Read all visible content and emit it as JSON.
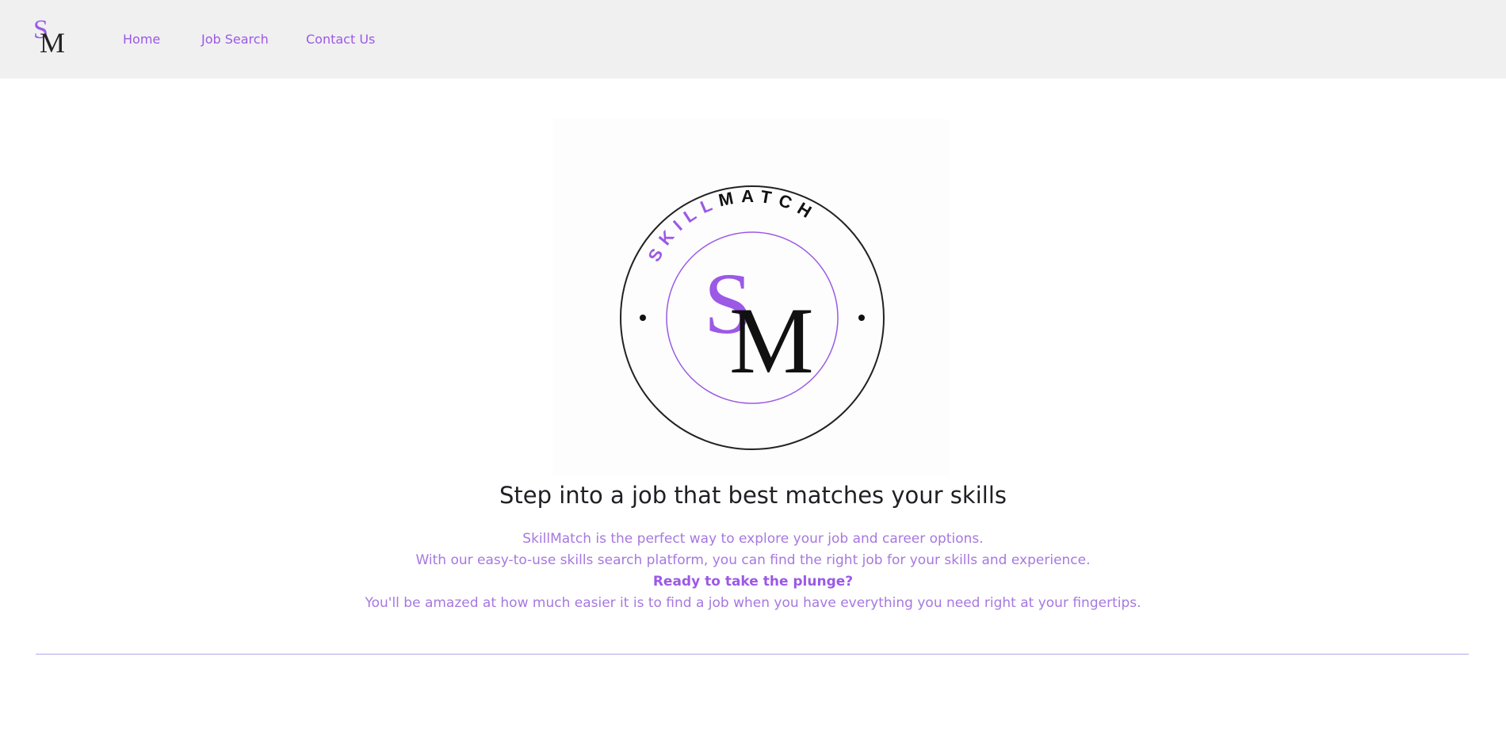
{
  "brand": {
    "logo_icon": "sm-monogram-logo",
    "circle_top_text": "SKILL",
    "circle_top_text_dark": "MATCH",
    "monogram_s": "S",
    "monogram_m": "M",
    "accent_color": "#9b59e6"
  },
  "nav": {
    "home": "Home",
    "job_search": "Job Search",
    "contact": "Contact Us"
  },
  "hero": {
    "headline": "Step into a job that best matches your skills",
    "line1": "SkillMatch is the perfect way to explore your job and career options.",
    "line2": "With our easy-to-use skills search platform, you can find the right job for your skills and experience.",
    "line3": "Ready to take the plunge?",
    "line4": "You'll be amazed at how much easier it is to find a job when you have everything you need right at your fingertips."
  }
}
